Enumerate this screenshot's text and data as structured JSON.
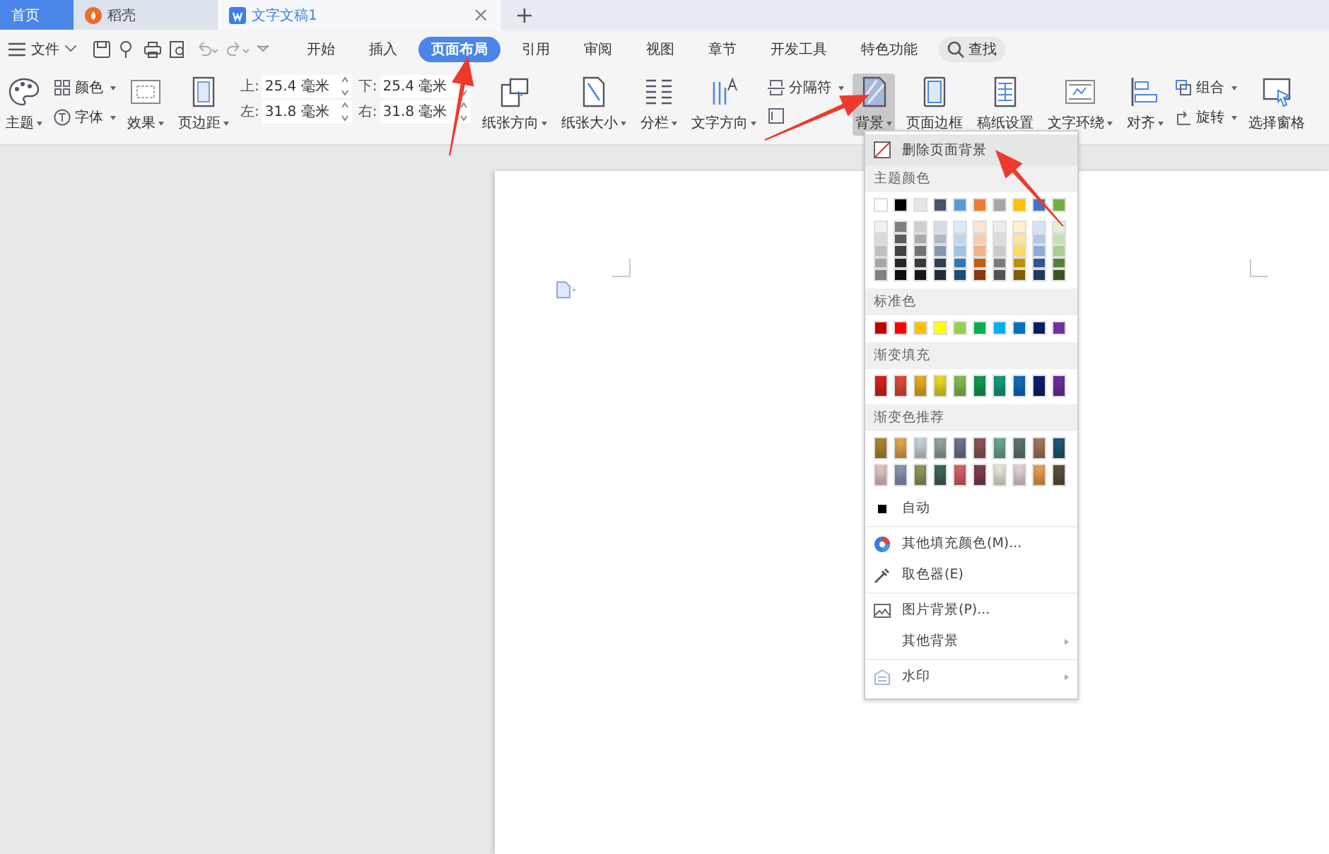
{
  "tab_bar": {
    "tabs": [
      {
        "label": "首页",
        "kind": "home",
        "selected": false
      },
      {
        "label": "稻壳",
        "kind": "app",
        "selected": false
      },
      {
        "label": "文字文稿1",
        "kind": "doc",
        "selected": true
      }
    ],
    "close": "×",
    "new_tab": "+"
  },
  "menu_bar": {
    "file_menu": "文件",
    "tabs": [
      {
        "label": "开始",
        "selected": false
      },
      {
        "label": "插入",
        "selected": false
      },
      {
        "label": "页面布局",
        "selected": true
      },
      {
        "label": "引用",
        "selected": false
      },
      {
        "label": "审阅",
        "selected": false
      },
      {
        "label": "视图",
        "selected": false
      },
      {
        "label": "章节",
        "selected": false
      },
      {
        "label": "开发工具",
        "selected": false
      },
      {
        "label": "特色功能",
        "selected": false
      }
    ],
    "search": "查找"
  },
  "ribbon": {
    "columns": [
      {
        "kind": "big",
        "label": "主题",
        "dropdown": true,
        "expanded": false
      },
      {
        "kind": "stack",
        "items": [
          {
            "label": "颜色",
            "dropdown": true
          },
          {
            "label": "字体",
            "dropdown": true
          }
        ]
      },
      {
        "kind": "big",
        "label": "效果",
        "dropdown": true,
        "expanded": false
      },
      {
        "kind": "big",
        "label": "页边距",
        "dropdown": true,
        "expanded": false
      },
      {
        "kind": "margins",
        "fields": [
          {
            "label": "上:",
            "value": "25.4 毫米"
          },
          {
            "label": "左:",
            "value": "31.8 毫米"
          },
          {
            "label": "下:",
            "value": "25.4 毫米"
          },
          {
            "label": "右:",
            "value": "31.8 毫米"
          }
        ]
      },
      {
        "kind": "big",
        "label": "纸张方向",
        "dropdown": true,
        "expanded": false
      },
      {
        "kind": "big",
        "label": "纸张大小",
        "dropdown": true,
        "expanded": false
      },
      {
        "kind": "big",
        "label": "分栏",
        "dropdown": true,
        "expanded": false
      },
      {
        "kind": "big",
        "label": "文字方向",
        "dropdown": true,
        "expanded": false
      },
      {
        "kind": "stack",
        "items": [
          {
            "label": "分隔符",
            "dropdown": true
          },
          {
            "dropdown": false
          }
        ]
      },
      {
        "kind": "big",
        "label": "背景",
        "dropdown": true,
        "expanded": true
      },
      {
        "kind": "big",
        "label": "页面边框",
        "dropdown": false,
        "expanded": false
      },
      {
        "kind": "big",
        "label": "稿纸设置",
        "dropdown": false,
        "expanded": false
      },
      {
        "kind": "big",
        "label": "文字环绕",
        "dropdown": true,
        "expanded": false
      },
      {
        "kind": "big",
        "label": "对齐",
        "dropdown": true,
        "expanded": false
      },
      {
        "kind": "stack",
        "items": [
          {
            "label": "组合",
            "dropdown": true
          },
          {
            "label": "旋转",
            "dropdown": true
          }
        ]
      },
      {
        "kind": "big",
        "label": "选择窗格",
        "dropdown": false,
        "expanded": false
      }
    ]
  },
  "background_menu": {
    "items": [
      {
        "kind": "action",
        "label": "删除页面背景",
        "highlighted": true,
        "submenu": false
      },
      {
        "kind": "header",
        "label": "主题颜色"
      },
      {
        "kind": "theme_swatches",
        "rows": [
          [
            {
              "color": "#ffffff"
            },
            {
              "color": "#000000"
            },
            {
              "color": "#e7e6e6"
            },
            {
              "color": "#44546a"
            },
            {
              "color": "#5b9bd5"
            },
            {
              "color": "#ed7d31"
            },
            {
              "color": "#a5a5a5"
            },
            {
              "color": "#ffc000"
            },
            {
              "color": "#4472c4"
            },
            {
              "color": "#70ad47"
            }
          ],
          [
            {
              "color": "#f2f2f2"
            },
            {
              "color": "#7f7f7f"
            },
            {
              "color": "#d0cece"
            },
            {
              "color": "#d6dce4"
            },
            {
              "color": "#deebf6"
            },
            {
              "color": "#fbe5d5"
            },
            {
              "color": "#ededed"
            },
            {
              "color": "#fff2cc"
            },
            {
              "color": "#d9e2f3"
            },
            {
              "color": "#e2efd9"
            }
          ],
          [
            {
              "color": "#d9d9d9"
            },
            {
              "color": "#595959"
            },
            {
              "color": "#aeaaaa"
            },
            {
              "color": "#adb9ca"
            },
            {
              "color": "#bdd7ee"
            },
            {
              "color": "#f7cbac"
            },
            {
              "color": "#dbdbdb"
            },
            {
              "color": "#ffe599"
            },
            {
              "color": "#b4c6e7"
            },
            {
              "color": "#c5e0b3"
            }
          ],
          [
            {
              "color": "#bfbfbf"
            },
            {
              "color": "#404040"
            },
            {
              "color": "#757171"
            },
            {
              "color": "#8497b0"
            },
            {
              "color": "#9dc3e6"
            },
            {
              "color": "#f4b183"
            },
            {
              "color": "#c9c9c9"
            },
            {
              "color": "#ffd966"
            },
            {
              "color": "#8eaadb"
            },
            {
              "color": "#a8d08d"
            }
          ],
          [
            {
              "color": "#a6a6a6"
            },
            {
              "color": "#262626"
            },
            {
              "color": "#3a3838"
            },
            {
              "color": "#333f4f"
            },
            {
              "color": "#2e75b5"
            },
            {
              "color": "#c55a11"
            },
            {
              "color": "#7b7b7b"
            },
            {
              "color": "#bf9000"
            },
            {
              "color": "#2f5496"
            },
            {
              "color": "#538135"
            }
          ],
          [
            {
              "color": "#808080"
            },
            {
              "color": "#0d0d0d"
            },
            {
              "color": "#171616"
            },
            {
              "color": "#222a35"
            },
            {
              "color": "#1f4e79"
            },
            {
              "color": "#843c0b"
            },
            {
              "color": "#525252"
            },
            {
              "color": "#7f6000"
            },
            {
              "color": "#1f3864"
            },
            {
              "color": "#375623"
            }
          ]
        ]
      },
      {
        "kind": "header",
        "label": "标准色"
      },
      {
        "kind": "swatches",
        "rows": [
          [
            {
              "color": "#c00000"
            },
            {
              "color": "#ff0000"
            },
            {
              "color": "#ffc000"
            },
            {
              "color": "#ffff00"
            },
            {
              "color": "#92d050"
            },
            {
              "color": "#00b050"
            },
            {
              "color": "#00b0f0"
            },
            {
              "color": "#0070c0"
            },
            {
              "color": "#002060"
            },
            {
              "color": "#7030a0"
            }
          ]
        ]
      },
      {
        "kind": "header",
        "label": "渐变填充"
      },
      {
        "kind": "gradient_swatches",
        "rows": [
          [
            {
              "color": "#e02020"
            },
            {
              "color": "#e84a3a"
            },
            {
              "color": "#f0b020"
            },
            {
              "color": "#f0e020"
            },
            {
              "color": "#8cc050"
            },
            {
              "color": "#10a050"
            },
            {
              "color": "#10a080"
            },
            {
              "color": "#1070c0"
            },
            {
              "color": "#102070"
            },
            {
              "color": "#7030a0"
            }
          ]
        ]
      },
      {
        "kind": "header",
        "label": "渐变色推荐"
      },
      {
        "kind": "gradient_swatches",
        "rows": [
          [
            {
              "color": "#b08a30"
            },
            {
              "color": "#e8a850"
            },
            {
              "color": "#c8d8e0"
            },
            {
              "color": "#98a8a0"
            },
            {
              "color": "#707890"
            },
            {
              "color": "#905858"
            },
            {
              "color": "#70a898"
            },
            {
              "color": "#607878"
            },
            {
              "color": "#a87858"
            },
            {
              "color": "#205878"
            }
          ],
          [
            {
              "color": "#e8c8c8"
            },
            {
              "color": "#8898b8"
            },
            {
              "color": "#989860"
            },
            {
              "color": "#406858"
            },
            {
              "color": "#e06070"
            },
            {
              "color": "#804050"
            },
            {
              "color": "#f0ece0"
            },
            {
              "color": "#e8d8e0"
            },
            {
              "color": "#f0a050"
            },
            {
              "color": "#605040"
            }
          ]
        ]
      },
      {
        "kind": "action",
        "label": "自动",
        "highlighted": false,
        "submenu": false
      },
      {
        "kind": "separator"
      },
      {
        "kind": "action",
        "label": "其他填充颜色(M)...",
        "highlighted": false,
        "submenu": false
      },
      {
        "kind": "action",
        "label": "取色器(E)",
        "highlighted": false,
        "submenu": false
      },
      {
        "kind": "separator"
      },
      {
        "kind": "action",
        "label": "图片背景(P)...",
        "highlighted": false,
        "submenu": false
      },
      {
        "kind": "action",
        "label": "其他背景",
        "highlighted": false,
        "submenu": true
      },
      {
        "kind": "separator"
      },
      {
        "kind": "action",
        "label": "水印",
        "highlighted": false,
        "submenu": true
      }
    ]
  }
}
